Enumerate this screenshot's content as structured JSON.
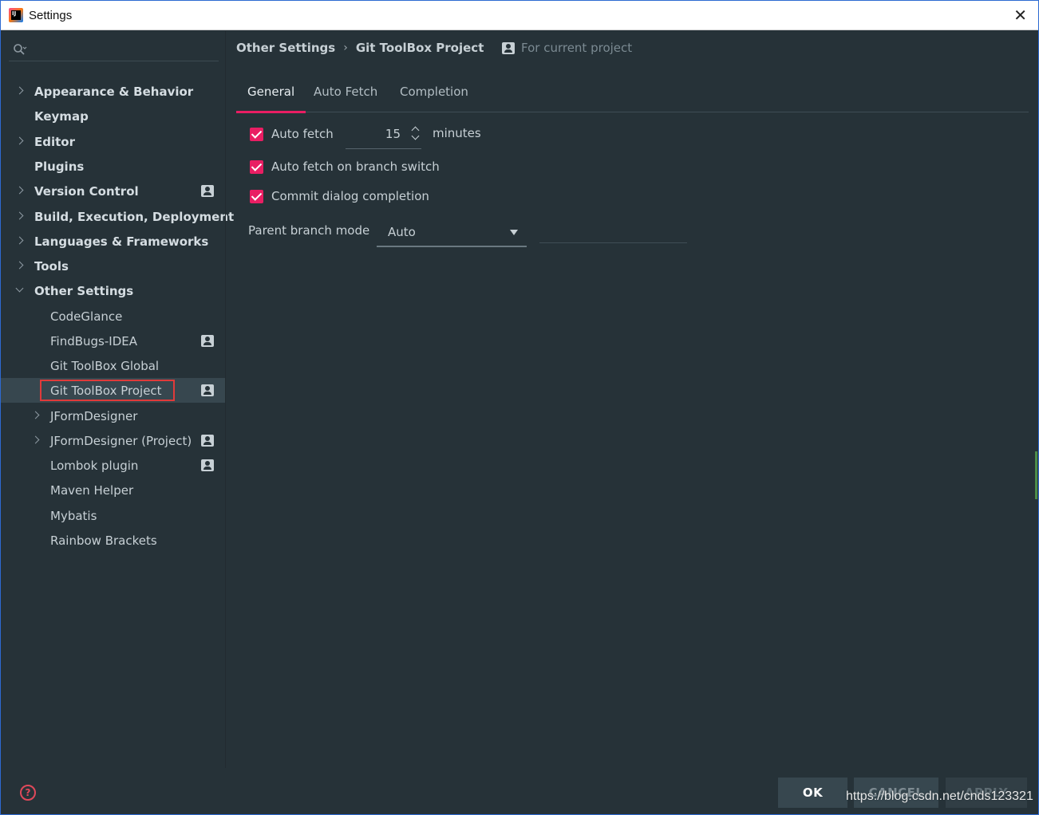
{
  "window": {
    "title": "Settings",
    "app_icon_text": "IJ",
    "close_glyph": "✕"
  },
  "sidebar": {
    "search_placeholder": "",
    "items": [
      {
        "label": "Appearance & Behavior",
        "level": 0,
        "arrow": "right",
        "project": false
      },
      {
        "label": "Keymap",
        "level": 0,
        "arrow": "none",
        "project": false
      },
      {
        "label": "Editor",
        "level": 0,
        "arrow": "right",
        "project": false
      },
      {
        "label": "Plugins",
        "level": 0,
        "arrow": "none",
        "project": false
      },
      {
        "label": "Version Control",
        "level": 0,
        "arrow": "right",
        "project": true
      },
      {
        "label": "Build, Execution, Deployment",
        "level": 0,
        "arrow": "right",
        "project": false
      },
      {
        "label": "Languages & Frameworks",
        "level": 0,
        "arrow": "right",
        "project": false
      },
      {
        "label": "Tools",
        "level": 0,
        "arrow": "right",
        "project": false
      },
      {
        "label": "Other Settings",
        "level": 0,
        "arrow": "down",
        "project": false
      },
      {
        "label": "CodeGlance",
        "level": 1,
        "arrow": "none",
        "project": false
      },
      {
        "label": "FindBugs-IDEA",
        "level": 1,
        "arrow": "none",
        "project": true
      },
      {
        "label": "Git ToolBox Global",
        "level": 1,
        "arrow": "none",
        "project": false
      },
      {
        "label": "Git ToolBox Project",
        "level": 1,
        "arrow": "none",
        "project": true,
        "selected": true
      },
      {
        "label": "JFormDesigner",
        "level": 1,
        "arrow": "right",
        "project": false
      },
      {
        "label": "JFormDesigner (Project)",
        "level": 1,
        "arrow": "right",
        "project": true
      },
      {
        "label": "Lombok plugin",
        "level": 1,
        "arrow": "none",
        "project": true
      },
      {
        "label": "Maven Helper",
        "level": 1,
        "arrow": "none",
        "project": false
      },
      {
        "label": "Mybatis",
        "level": 1,
        "arrow": "none",
        "project": false
      },
      {
        "label": "Rainbow Brackets",
        "level": 1,
        "arrow": "none",
        "project": false
      }
    ]
  },
  "main": {
    "breadcrumb": {
      "parent": "Other Settings",
      "separator": "›",
      "current": "Git ToolBox Project"
    },
    "scope_label": "For current project",
    "tabs": [
      {
        "label": "General",
        "active": true
      },
      {
        "label": "Auto Fetch",
        "active": false
      },
      {
        "label": "Completion",
        "active": false
      }
    ],
    "options": {
      "auto_fetch": {
        "label": "Auto fetch",
        "checked": true
      },
      "auto_fetch_interval": {
        "value": "15",
        "unit": "minutes"
      },
      "auto_fetch_branch_switch": {
        "label": "Auto fetch on branch switch",
        "checked": true
      },
      "commit_dialog_completion": {
        "label": "Commit dialog completion",
        "checked": true
      }
    },
    "parent_branch_mode": {
      "label": "Parent branch mode",
      "value": "Auto"
    }
  },
  "footer": {
    "help_glyph": "?",
    "ok_label": "OK",
    "cancel_label": "CANCEL",
    "apply_label": "APPLY"
  },
  "watermark": "https://blog.csdn.net/cnds123321",
  "colors": {
    "background": "#263238",
    "accent": "#e91e63",
    "selection": "#37474f",
    "highlight_border": "#e03a3a"
  }
}
